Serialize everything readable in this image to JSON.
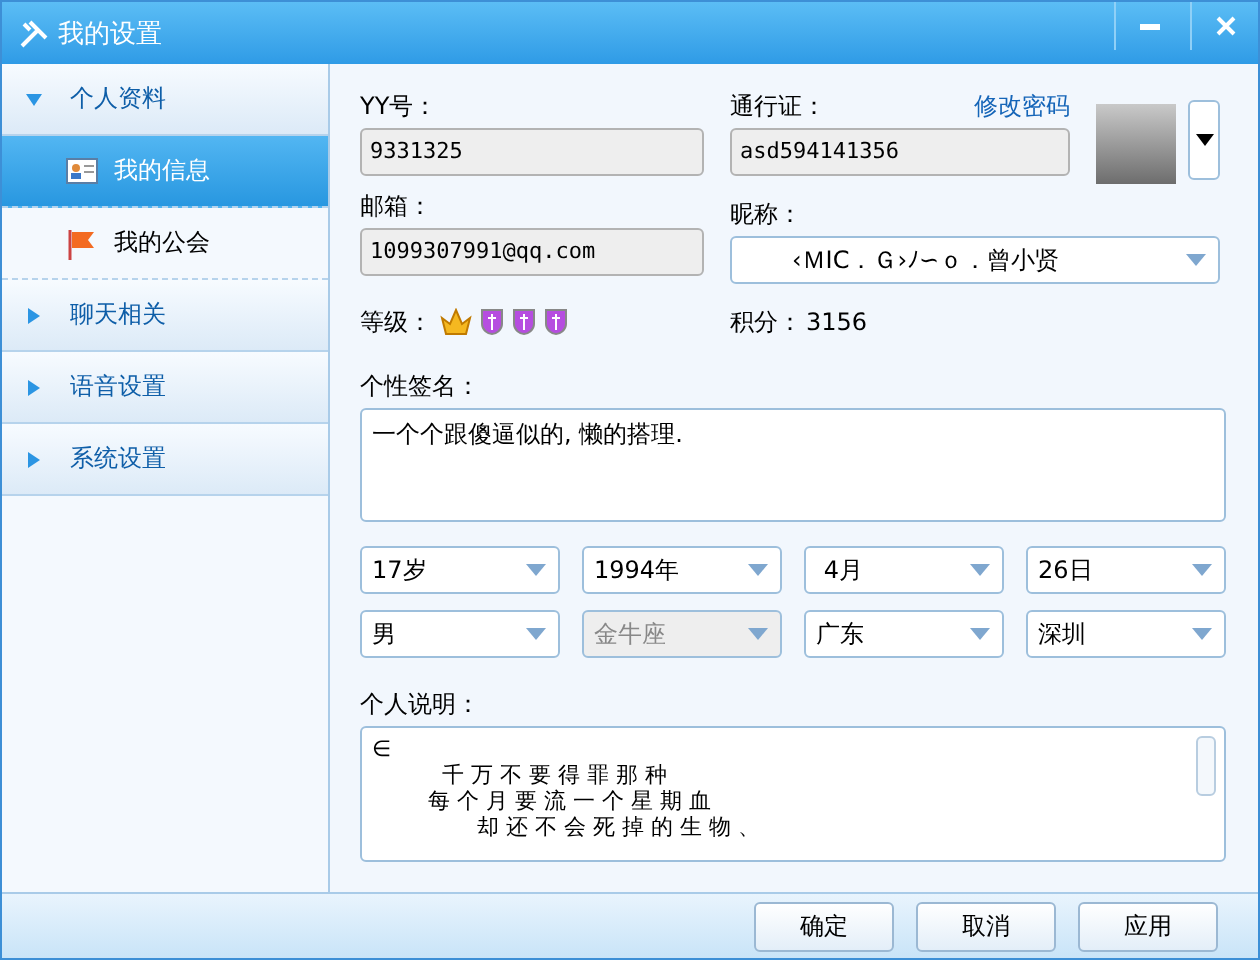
{
  "window": {
    "title": "我的设置"
  },
  "sidebar": [
    {
      "label": "个人资料",
      "expanded": true,
      "children": [
        {
          "label": "我的信息",
          "kind": "card",
          "selected": true
        },
        {
          "label": "我的公会",
          "kind": "flag",
          "selected": false
        }
      ]
    },
    {
      "label": "聊天相关",
      "expanded": false
    },
    {
      "label": "语音设置",
      "expanded": false
    },
    {
      "label": "系统设置",
      "expanded": false
    }
  ],
  "profile": {
    "yy_label": "YY号：",
    "yy_value": "9331325",
    "passport_label": "通行证：",
    "passport_value": "asd594141356",
    "change_password": "修改密码",
    "email_label": "邮箱：",
    "email_value": "1099307991@qq.com",
    "nickname_label": "昵称：",
    "nickname_value": "‹ＭIC．Ｇ›ﾉ∽ｏ．曾小贤",
    "level_label": "等级：",
    "badges": [
      {
        "kind": "crown"
      },
      {
        "kind": "shield"
      },
      {
        "kind": "shield"
      },
      {
        "kind": "shield"
      }
    ],
    "points_label": "积分：",
    "points_value": "3156",
    "signature_label": "个性签名：",
    "signature_value": "一个个跟傻逼似的, 懒的搭理.",
    "selects": [
      {
        "value": "17岁",
        "disabled": false
      },
      {
        "value": "1994年",
        "disabled": false
      },
      {
        "value": " 4月",
        "disabled": false
      },
      {
        "value": "26日",
        "disabled": false
      },
      {
        "value": "男",
        "disabled": false
      },
      {
        "value": "金牛座",
        "disabled": true
      },
      {
        "value": "广东",
        "disabled": false
      },
      {
        "value": "深圳",
        "disabled": false
      }
    ],
    "about_label": "个人说明：",
    "about_lines": [
      "∈",
      "          千 万 不 要 得 罪 那 种",
      "        每 个 月 要 流 一 个 星 期 血",
      "               却 还 不 会 死 掉 的 生 物 、"
    ]
  },
  "buttons": [
    "确定",
    "取消",
    "应用"
  ]
}
